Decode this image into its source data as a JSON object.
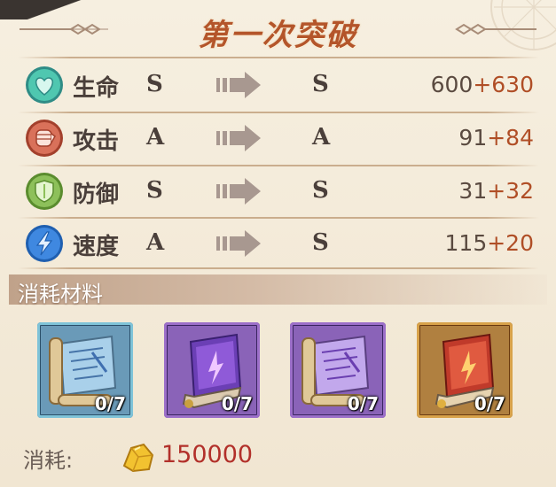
{
  "title": "第一次突破",
  "stats": [
    {
      "name": "生命",
      "icon": "heart-icon",
      "from_grade": "S",
      "to_grade": "S",
      "base": "600",
      "bonus": "+630"
    },
    {
      "name": "攻击",
      "icon": "fist-icon",
      "from_grade": "A",
      "to_grade": "A",
      "base": "91",
      "bonus": "+84"
    },
    {
      "name": "防御",
      "icon": "shield-icon",
      "from_grade": "S",
      "to_grade": "S",
      "base": "31",
      "bonus": "+32"
    },
    {
      "name": "速度",
      "icon": "lightning-icon",
      "from_grade": "A",
      "to_grade": "S",
      "base": "115",
      "bonus": "+20"
    }
  ],
  "materials": {
    "title": "消耗材料",
    "items": [
      {
        "icon": "blue-scroll-icon",
        "count": "0/7",
        "frame_color": "#7fc3d8"
      },
      {
        "icon": "purple-book-icon",
        "count": "0/7",
        "frame_color": "#9c6fc9"
      },
      {
        "icon": "purple-scroll-icon",
        "count": "0/7",
        "frame_color": "#9c6fc9"
      },
      {
        "icon": "red-book-icon",
        "count": "0/7",
        "frame_color": "#d8a24a"
      }
    ]
  },
  "cost": {
    "label": "消耗:",
    "icon": "gold-icon",
    "value": "150000"
  },
  "colors": {
    "accent": "#b04e26",
    "cost": "#b2302a",
    "heart": "#4fc7b0",
    "fist": "#d9715a",
    "shield": "#8dc05a",
    "lightning": "#3f88e0"
  }
}
